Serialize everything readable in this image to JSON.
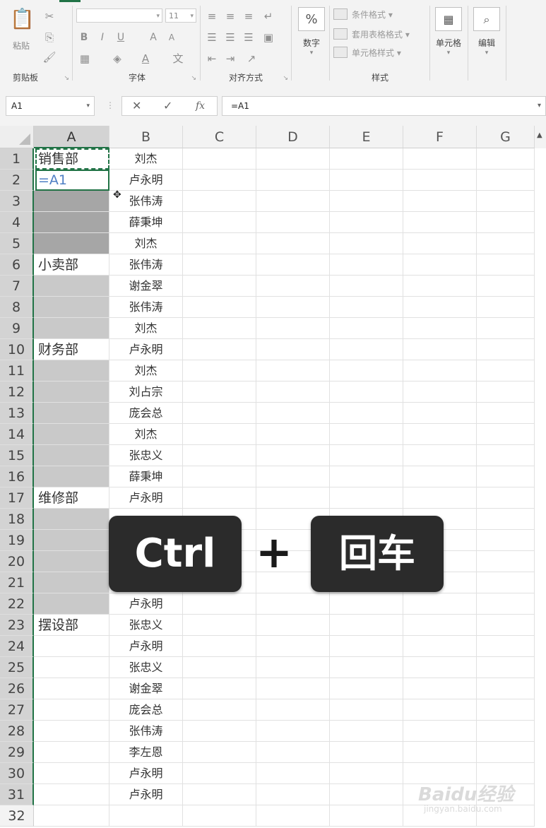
{
  "ribbon": {
    "groups": {
      "clipboard": "剪贴板",
      "font": "字体",
      "alignment": "对齐方式",
      "number": "数字",
      "styles": "样式",
      "cells": "单元格",
      "editing": "编辑"
    },
    "paste_label": "粘贴",
    "font_size": "11",
    "bold": "B",
    "italic": "I",
    "underline": "U",
    "grow_font": "A",
    "shrink_font": "A",
    "percent": "%",
    "conditional_format": "条件格式",
    "table_format": "套用表格格式",
    "cell_styles": "单元格样式"
  },
  "formula_bar": {
    "name_box": "A1",
    "formula": "=A1",
    "fx": "fx"
  },
  "columns": [
    "A",
    "B",
    "C",
    "D",
    "E",
    "F",
    "G"
  ],
  "rows": [
    {
      "n": "1",
      "a": "销售部",
      "b": "刘杰"
    },
    {
      "n": "2",
      "a": "=A1",
      "b": "卢永明"
    },
    {
      "n": "3",
      "a": "",
      "b": "张伟涛"
    },
    {
      "n": "4",
      "a": "",
      "b": "薛秉坤"
    },
    {
      "n": "5",
      "a": "",
      "b": "刘杰"
    },
    {
      "n": "6",
      "a": "小卖部",
      "b": "张伟涛"
    },
    {
      "n": "7",
      "a": "",
      "b": "谢金翠"
    },
    {
      "n": "8",
      "a": "",
      "b": "张伟涛"
    },
    {
      "n": "9",
      "a": "",
      "b": "刘杰"
    },
    {
      "n": "10",
      "a": "财务部",
      "b": "卢永明"
    },
    {
      "n": "11",
      "a": "",
      "b": "刘杰"
    },
    {
      "n": "12",
      "a": "",
      "b": "刘占宗"
    },
    {
      "n": "13",
      "a": "",
      "b": "庞会总"
    },
    {
      "n": "14",
      "a": "",
      "b": "刘杰"
    },
    {
      "n": "15",
      "a": "",
      "b": "张忠义"
    },
    {
      "n": "16",
      "a": "",
      "b": "薛秉坤"
    },
    {
      "n": "17",
      "a": "维修部",
      "b": "卢永明"
    },
    {
      "n": "18",
      "a": "",
      "b": ""
    },
    {
      "n": "19",
      "a": "",
      "b": ""
    },
    {
      "n": "20",
      "a": "",
      "b": ""
    },
    {
      "n": "21",
      "a": "",
      "b": ""
    },
    {
      "n": "22",
      "a": "",
      "b": "卢永明"
    },
    {
      "n": "23",
      "a": "摆设部",
      "b": "张忠义"
    },
    {
      "n": "24",
      "a": "",
      "b": "卢永明"
    },
    {
      "n": "25",
      "a": "",
      "b": "张忠义"
    },
    {
      "n": "26",
      "a": "",
      "b": "谢金翠"
    },
    {
      "n": "27",
      "a": "",
      "b": "庞会总"
    },
    {
      "n": "28",
      "a": "",
      "b": "张伟涛"
    },
    {
      "n": "29",
      "a": "",
      "b": "李左恩"
    },
    {
      "n": "30",
      "a": "",
      "b": "卢永明"
    },
    {
      "n": "31",
      "a": "",
      "b": "卢永明"
    },
    {
      "n": "32",
      "a": "",
      "b": ""
    }
  ],
  "overlay": {
    "key1": "Ctrl",
    "plus": "+",
    "key2": "回车"
  },
  "watermark": {
    "brand": "Baidu经验",
    "url": "jingyan.baidu.com"
  }
}
